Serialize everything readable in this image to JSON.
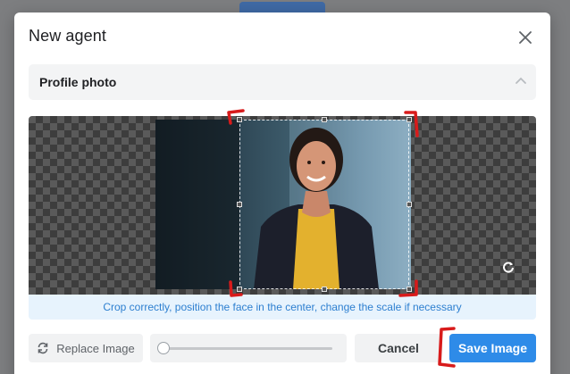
{
  "modal": {
    "title": "New agent",
    "close_icon": "close-icon"
  },
  "section": {
    "title": "Profile photo",
    "toggle_icon": "chevron-up-icon"
  },
  "cropper": {
    "rotate_icon": "rotate-icon",
    "hint": "Crop correctly, position the face in the center, change the scale if necessary"
  },
  "footer": {
    "replace_label": "Replace Image",
    "replace_icon": "refresh-icon",
    "zoom_level": 0,
    "cancel_label": "Cancel",
    "save_label": "Save Image"
  },
  "colors": {
    "primary": "#2e8be8",
    "hint_text": "#2d7fd0",
    "hint_bg": "#e7f3fd",
    "annotation": "#d81b1b"
  }
}
